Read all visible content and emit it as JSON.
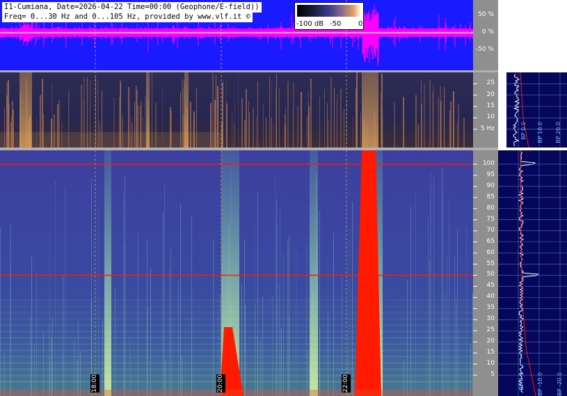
{
  "header": {
    "line1": "I1-Cumiana, Date=2026-04-22 Time=00:00 (Geophone/E-field))",
    "line2": "Freq= 0...30 Hz and 0...105 Hz, provided by www.vlf.it ©"
  },
  "legend": {
    "labels": [
      "-100 dB",
      "-50",
      "0"
    ]
  },
  "colors": {
    "waveform_bg": "#1a1aff",
    "waveform_trace": "#ff00ff",
    "spec_low_bg": "#2a2a55",
    "spec_high_bg": "#3a3f9a",
    "event_red": "#ff1a00",
    "axis_panel_bg": "#8f8f8f",
    "side_panel_bg": "#06065a",
    "side_grid": "#4a78c8",
    "time_marker": "#c8a060"
  },
  "chart_data": [
    {
      "type": "line",
      "panel": "waveform",
      "ylabel_ticks": [
        "50 %",
        "0 %",
        "-50 %"
      ],
      "ylim": [
        -100,
        100
      ]
    },
    {
      "type": "heatmap",
      "panel": "spectrogram-0-30Hz",
      "yticks": [
        5,
        10,
        15,
        20,
        25
      ],
      "ytick_labels": [
        "5 Hz",
        "10",
        "15",
        "20",
        "25"
      ],
      "ylim": [
        0,
        30
      ],
      "side_plot_labels": [
        "BP 0.0",
        "BP 10.0",
        "BP 20.0"
      ]
    },
    {
      "type": "heatmap",
      "panel": "spectrogram-0-105Hz",
      "yticks": [
        5,
        10,
        15,
        20,
        25,
        30,
        35,
        40,
        45,
        50,
        55,
        60,
        65,
        70,
        75,
        80,
        85,
        90,
        95,
        100
      ],
      "ytick_labels": [
        "5",
        "10",
        "15",
        "20",
        "25",
        "30",
        "35",
        "40",
        "45",
        "50",
        "55",
        "60",
        "65",
        "70",
        "75",
        "80",
        "85",
        "90",
        "95",
        "100"
      ],
      "ylim": [
        0,
        105
      ],
      "side_plot_labels": [
        "BP 0.0",
        "BP -10.0",
        "BP -20.0"
      ],
      "time_labels": [
        "18:00",
        "20:00",
        "22:00"
      ],
      "horizontal_lines_hz": [
        50,
        100
      ]
    }
  ]
}
